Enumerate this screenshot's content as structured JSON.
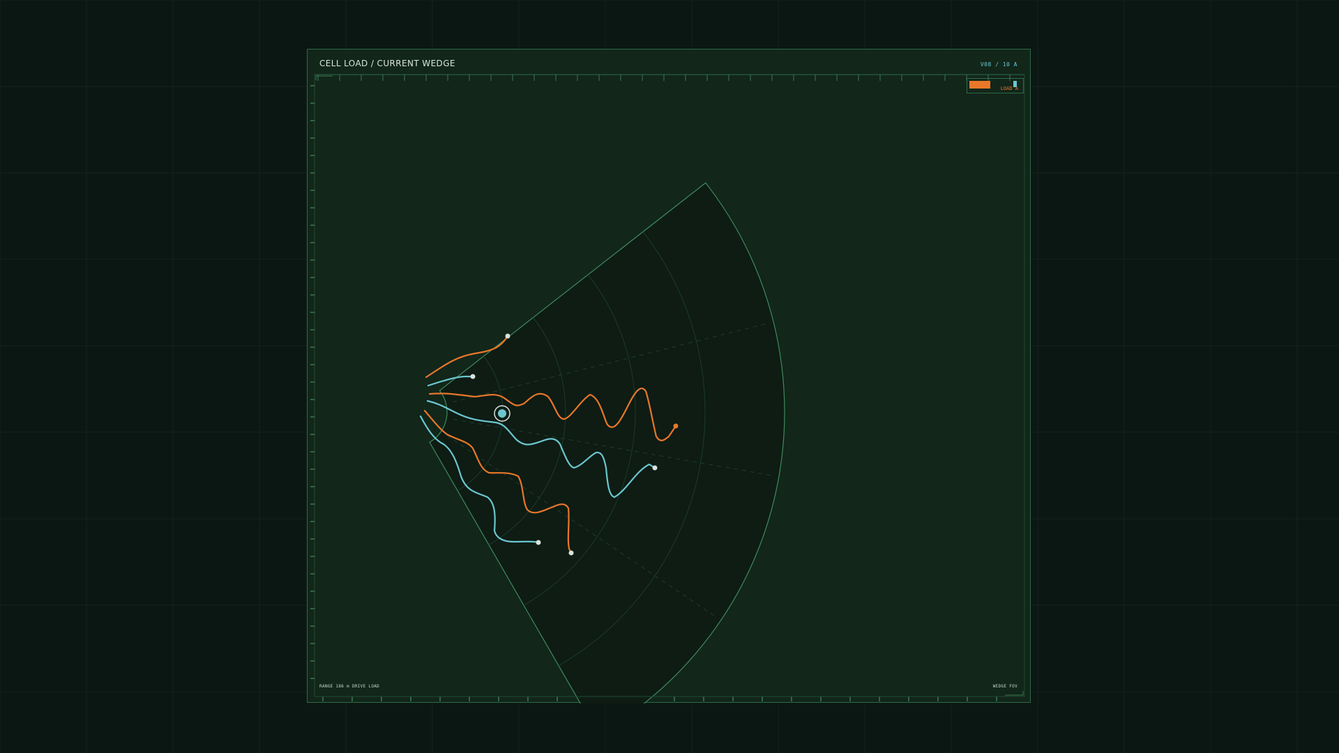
{
  "header": {
    "title": "CELL LOAD / CURRENT WEDGE",
    "readout": "V08 / 10 A"
  },
  "legend": {
    "label": "LOAD A"
  },
  "footer": {
    "left": "RANGE 186 m  DRIVE LOAD",
    "right": "WEDGE FOV"
  },
  "colors": {
    "background": "#0b1713",
    "panel": "#12261a",
    "wedge_fill": "#0e1c14",
    "frame": "#2f6a45",
    "orange": "#e8772a",
    "cyan": "#6bc7cf",
    "endpoint": "#d9e3dc"
  },
  "traces": [
    {
      "id": "trace-1",
      "color": "orange",
      "end": "white"
    },
    {
      "id": "trace-2",
      "color": "cyan",
      "end": "white"
    },
    {
      "id": "trace-3",
      "color": "orange",
      "end": "orange"
    },
    {
      "id": "trace-4",
      "color": "cyan",
      "end": "white"
    },
    {
      "id": "trace-5",
      "color": "orange",
      "end": "white"
    },
    {
      "id": "trace-6",
      "color": "cyan",
      "end": "white"
    }
  ],
  "target_marker": {
    "icon": "target-ring-icon"
  }
}
